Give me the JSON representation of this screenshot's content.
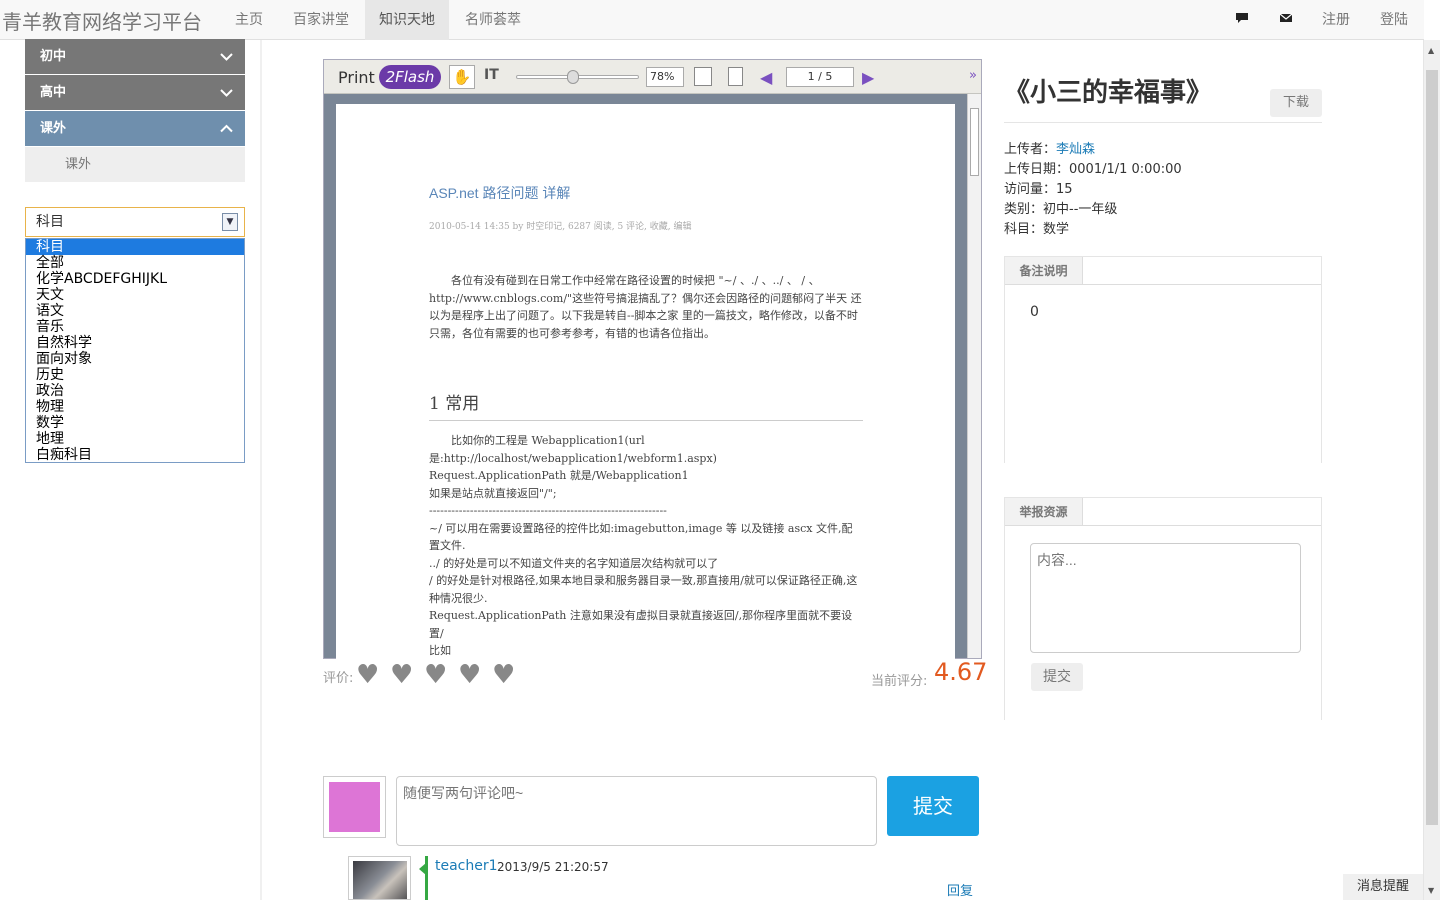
{
  "header": {
    "brand": "青羊教育网络学习平台",
    "nav": [
      "主页",
      "百家讲堂",
      "知识天地",
      "名师荟萃"
    ],
    "register": "注册",
    "login": "登陆"
  },
  "sidebar": {
    "items": [
      {
        "label": "初中",
        "chevron": "chevron-down-icon"
      },
      {
        "label": "高中",
        "chevron": "chevron-down-icon"
      },
      {
        "label": "课外",
        "chevron": "chevron-up-icon"
      }
    ],
    "sub_item": "课外",
    "subject_select": {
      "selected": "科目",
      "options": [
        "科目",
        "全部",
        "化学ABCDEFGHIJKL",
        "天文",
        "语文",
        "音乐",
        "自然科学",
        "面向对象",
        "历史",
        "政治",
        "物理",
        "数学",
        "地理",
        "白痴科目"
      ]
    }
  },
  "viewer": {
    "logo_print": "Print",
    "logo_flash": "2Flash",
    "zoom": "78%",
    "page": "1 / 5",
    "zoom_level": 0.45,
    "doc": {
      "title": "ASP.net 路径问题 详解",
      "byline": "2010-05-14 14:35 by 时空印记, 6287 阅读, 5 评论, 收藏, 编辑",
      "para1": "各位有没有碰到在日常工作中经常在路径设置的时候把 \"~/ 、./ 、../ 、 / 、http://www.cnblogs.com/\"这些符号搞混搞乱了？偶尔还会因路径的问题郁闷了半天 还以为是程序上出了问题了。以下我是转自--脚本之家 里的一篇技文，略作修改，以备不时只需，各位有需要的也可参考参考，有错的也请各位指出。",
      "heading": "1  常用",
      "lines": [
        "比如你的工程是 Webapplication1(url 是:http://localhost/webapplication1/webform1.aspx)",
        "Request.ApplicationPath  就是/Webapplication1",
        "如果是站点就直接返回\"/\";",
        "----------------------------------------------------------------",
        "~/  可以用在需要设置路径的控件比如:imagebutton,image 等  以及链接 ascx 文件,配置文件.",
        "../  的好处是可以不知道文件夹的名字知道层次结构就可以了",
        "/  的好处是针对根路径,如果本地目录和服务器目录一致,那直接用/就可以保证路径正确,这种情况很少.",
        "Request.ApplicationPath  注意如果没有虚拟目录就直接返回/,那你程序里面就不要设置/",
        "比如"
      ]
    }
  },
  "rating": {
    "label": "评价:",
    "stars": 5,
    "score_label": "当前评分:",
    "score": "4.67"
  },
  "comment": {
    "placeholder": "随便写两句评论吧~",
    "submit": "提交",
    "avatar_color": "#dd75d6"
  },
  "comments": [
    {
      "user": "teacher1",
      "time": "2013/9/5 21:20:57",
      "reply": "回复"
    }
  ],
  "resource": {
    "title": "《小三的幸福事》",
    "download": "下载",
    "meta": [
      {
        "label": "上传者：",
        "value": "李灿森",
        "link": true
      },
      {
        "label": "上传日期：",
        "value": "0001/1/1 0:00:00",
        "link": false
      },
      {
        "label": "访问量：",
        "value": "15",
        "link": false
      },
      {
        "label": "类别：",
        "value": "初中--一年级",
        "link": false
      },
      {
        "label": "科目：",
        "value": "数学",
        "link": false
      }
    ],
    "note_tab": "备注说明",
    "note_value": "0",
    "report_tab": "举报资源",
    "report_placeholder": "内容...",
    "report_submit": "提交"
  },
  "footer": {
    "message": "消息提醒"
  },
  "colors": {
    "accent": "#1ba1e2",
    "score": "#e25a20",
    "sidebar": "#777777",
    "sidebar_active": "#6f8fad",
    "link": "#1b7bb6"
  }
}
